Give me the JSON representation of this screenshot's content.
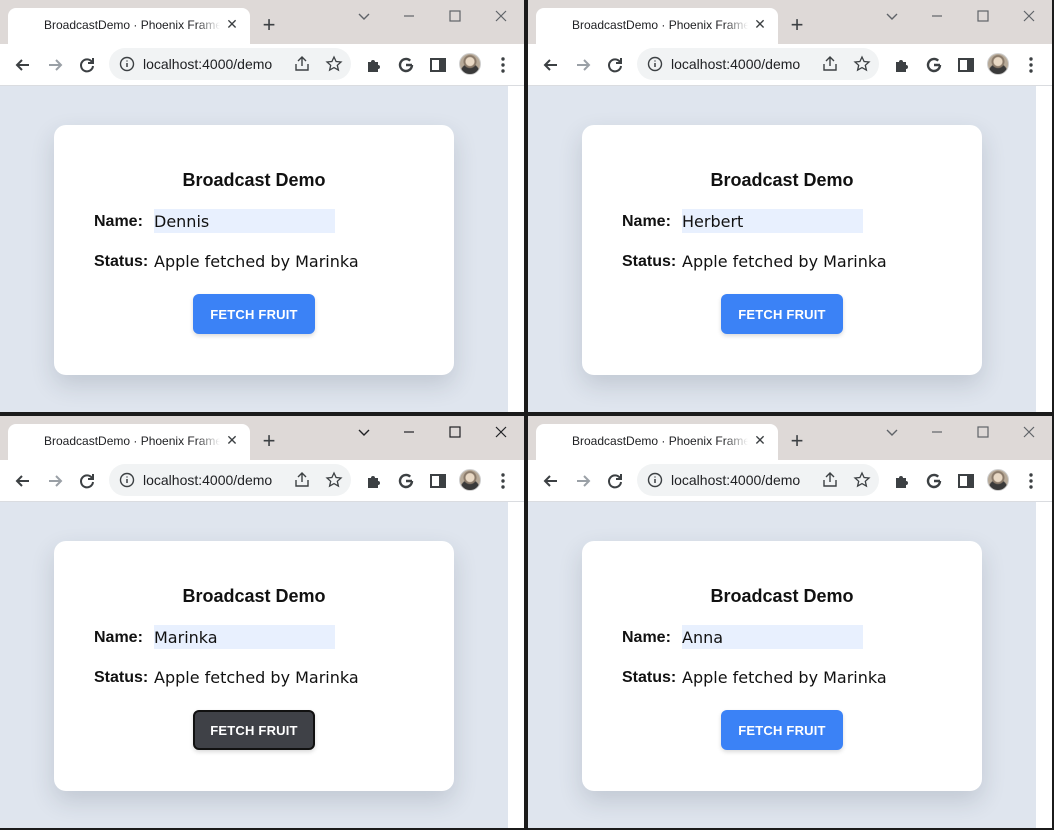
{
  "windows": [
    {
      "tab_title": "BroadcastDemo · Phoenix Framework",
      "url": "localhost:4000/demo",
      "heading": "Broadcast Demo",
      "name_label": "Name:",
      "name_value": "Dennis",
      "status_label": "Status:",
      "status_value": "Apple fetched by Marinka",
      "button_label": "FETCH FRUIT",
      "button_state": "normal"
    },
    {
      "tab_title": "BroadcastDemo · Phoenix Framework",
      "url": "localhost:4000/demo",
      "heading": "Broadcast Demo",
      "name_label": "Name:",
      "name_value": "Herbert",
      "status_label": "Status:",
      "status_value": "Apple fetched by Marinka",
      "button_label": "FETCH FRUIT",
      "button_state": "normal"
    },
    {
      "tab_title": "BroadcastDemo · Phoenix Framework",
      "url": "localhost:4000/demo",
      "heading": "Broadcast Demo",
      "name_label": "Name:",
      "name_value": "Marinka",
      "status_label": "Status:",
      "status_value": "Apple fetched by Marinka",
      "button_label": "FETCH FRUIT",
      "button_state": "pressed"
    },
    {
      "tab_title": "BroadcastDemo · Phoenix Framework",
      "url": "localhost:4000/demo",
      "heading": "Broadcast Demo",
      "name_label": "Name:",
      "name_value": "Anna",
      "status_label": "Status:",
      "status_value": "Apple fetched by Marinka",
      "button_label": "FETCH FRUIT",
      "button_state": "normal"
    }
  ],
  "icons": {
    "tab_close": "close-icon",
    "new_tab": "plus-icon",
    "back": "arrow-left-icon",
    "forward": "arrow-right-icon",
    "reload": "reload-icon",
    "site_info": "info-icon",
    "share": "share-icon",
    "bookmark": "star-icon",
    "extensions": "puzzle-icon",
    "google": "google-icon",
    "side_panel": "side-panel-icon",
    "profile": "avatar",
    "menu": "kebab-menu-icon"
  },
  "colors": {
    "button_primary": "#3b82f6",
    "button_pressed": "#3f4147",
    "page_background": "#dfe5ee",
    "input_background": "#e8f0fe",
    "tab_strip": "#ded9d7"
  }
}
